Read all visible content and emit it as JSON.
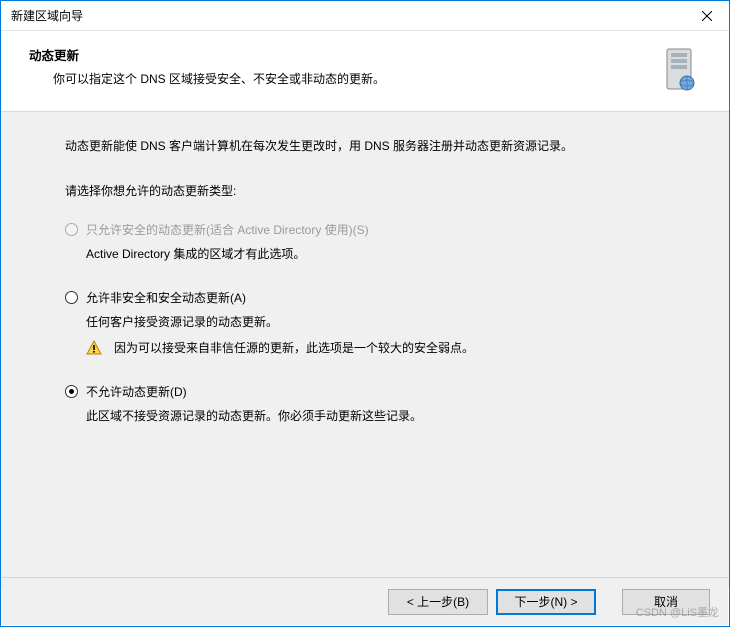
{
  "window": {
    "title": "新建区域向导"
  },
  "header": {
    "title": "动态更新",
    "subtitle": "你可以指定这个 DNS 区域接受安全、不安全或非动态的更新。"
  },
  "body": {
    "intro": "动态更新能使 DNS 客户端计算机在每次发生更改时，用 DNS 服务器注册并动态更新资源记录。",
    "prompt": "请选择你想允许的动态更新类型:",
    "options": [
      {
        "label": "只允许安全的动态更新(适合 Active Directory 使用)(S)",
        "desc": "Active Directory 集成的区域才有此选项。",
        "disabled": true,
        "selected": false
      },
      {
        "label": "允许非安全和安全动态更新(A)",
        "desc": "任何客户接受资源记录的动态更新。",
        "warning": "因为可以接受来自非信任源的更新，此选项是一个较大的安全弱点。",
        "disabled": false,
        "selected": false
      },
      {
        "label": "不允许动态更新(D)",
        "desc": "此区域不接受资源记录的动态更新。你必须手动更新这些记录。",
        "disabled": false,
        "selected": true
      }
    ]
  },
  "footer": {
    "back": "< 上一步(B)",
    "next": "下一步(N) >",
    "cancel": "取消"
  },
  "watermark": "CSDN @LiS墨龙"
}
